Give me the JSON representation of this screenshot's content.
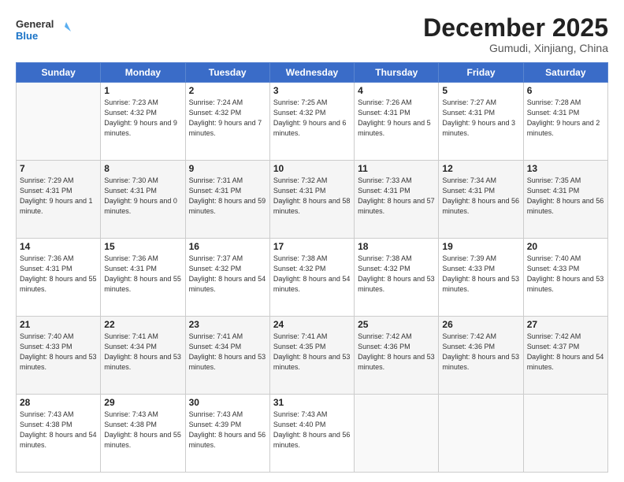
{
  "header": {
    "logo_line1": "General",
    "logo_line2": "Blue",
    "month": "December 2025",
    "location": "Gumudi, Xinjiang, China"
  },
  "weekdays": [
    "Sunday",
    "Monday",
    "Tuesday",
    "Wednesday",
    "Thursday",
    "Friday",
    "Saturday"
  ],
  "weeks": [
    [
      {
        "day": "",
        "sunrise": "",
        "sunset": "",
        "daylight": ""
      },
      {
        "day": "1",
        "sunrise": "Sunrise: 7:23 AM",
        "sunset": "Sunset: 4:32 PM",
        "daylight": "Daylight: 9 hours and 9 minutes."
      },
      {
        "day": "2",
        "sunrise": "Sunrise: 7:24 AM",
        "sunset": "Sunset: 4:32 PM",
        "daylight": "Daylight: 9 hours and 7 minutes."
      },
      {
        "day": "3",
        "sunrise": "Sunrise: 7:25 AM",
        "sunset": "Sunset: 4:32 PM",
        "daylight": "Daylight: 9 hours and 6 minutes."
      },
      {
        "day": "4",
        "sunrise": "Sunrise: 7:26 AM",
        "sunset": "Sunset: 4:31 PM",
        "daylight": "Daylight: 9 hours and 5 minutes."
      },
      {
        "day": "5",
        "sunrise": "Sunrise: 7:27 AM",
        "sunset": "Sunset: 4:31 PM",
        "daylight": "Daylight: 9 hours and 3 minutes."
      },
      {
        "day": "6",
        "sunrise": "Sunrise: 7:28 AM",
        "sunset": "Sunset: 4:31 PM",
        "daylight": "Daylight: 9 hours and 2 minutes."
      }
    ],
    [
      {
        "day": "7",
        "sunrise": "Sunrise: 7:29 AM",
        "sunset": "Sunset: 4:31 PM",
        "daylight": "Daylight: 9 hours and 1 minute."
      },
      {
        "day": "8",
        "sunrise": "Sunrise: 7:30 AM",
        "sunset": "Sunset: 4:31 PM",
        "daylight": "Daylight: 9 hours and 0 minutes."
      },
      {
        "day": "9",
        "sunrise": "Sunrise: 7:31 AM",
        "sunset": "Sunset: 4:31 PM",
        "daylight": "Daylight: 8 hours and 59 minutes."
      },
      {
        "day": "10",
        "sunrise": "Sunrise: 7:32 AM",
        "sunset": "Sunset: 4:31 PM",
        "daylight": "Daylight: 8 hours and 58 minutes."
      },
      {
        "day": "11",
        "sunrise": "Sunrise: 7:33 AM",
        "sunset": "Sunset: 4:31 PM",
        "daylight": "Daylight: 8 hours and 57 minutes."
      },
      {
        "day": "12",
        "sunrise": "Sunrise: 7:34 AM",
        "sunset": "Sunset: 4:31 PM",
        "daylight": "Daylight: 8 hours and 56 minutes."
      },
      {
        "day": "13",
        "sunrise": "Sunrise: 7:35 AM",
        "sunset": "Sunset: 4:31 PM",
        "daylight": "Daylight: 8 hours and 56 minutes."
      }
    ],
    [
      {
        "day": "14",
        "sunrise": "Sunrise: 7:36 AM",
        "sunset": "Sunset: 4:31 PM",
        "daylight": "Daylight: 8 hours and 55 minutes."
      },
      {
        "day": "15",
        "sunrise": "Sunrise: 7:36 AM",
        "sunset": "Sunset: 4:31 PM",
        "daylight": "Daylight: 8 hours and 55 minutes."
      },
      {
        "day": "16",
        "sunrise": "Sunrise: 7:37 AM",
        "sunset": "Sunset: 4:32 PM",
        "daylight": "Daylight: 8 hours and 54 minutes."
      },
      {
        "day": "17",
        "sunrise": "Sunrise: 7:38 AM",
        "sunset": "Sunset: 4:32 PM",
        "daylight": "Daylight: 8 hours and 54 minutes."
      },
      {
        "day": "18",
        "sunrise": "Sunrise: 7:38 AM",
        "sunset": "Sunset: 4:32 PM",
        "daylight": "Daylight: 8 hours and 53 minutes."
      },
      {
        "day": "19",
        "sunrise": "Sunrise: 7:39 AM",
        "sunset": "Sunset: 4:33 PM",
        "daylight": "Daylight: 8 hours and 53 minutes."
      },
      {
        "day": "20",
        "sunrise": "Sunrise: 7:40 AM",
        "sunset": "Sunset: 4:33 PM",
        "daylight": "Daylight: 8 hours and 53 minutes."
      }
    ],
    [
      {
        "day": "21",
        "sunrise": "Sunrise: 7:40 AM",
        "sunset": "Sunset: 4:33 PM",
        "daylight": "Daylight: 8 hours and 53 minutes."
      },
      {
        "day": "22",
        "sunrise": "Sunrise: 7:41 AM",
        "sunset": "Sunset: 4:34 PM",
        "daylight": "Daylight: 8 hours and 53 minutes."
      },
      {
        "day": "23",
        "sunrise": "Sunrise: 7:41 AM",
        "sunset": "Sunset: 4:34 PM",
        "daylight": "Daylight: 8 hours and 53 minutes."
      },
      {
        "day": "24",
        "sunrise": "Sunrise: 7:41 AM",
        "sunset": "Sunset: 4:35 PM",
        "daylight": "Daylight: 8 hours and 53 minutes."
      },
      {
        "day": "25",
        "sunrise": "Sunrise: 7:42 AM",
        "sunset": "Sunset: 4:36 PM",
        "daylight": "Daylight: 8 hours and 53 minutes."
      },
      {
        "day": "26",
        "sunrise": "Sunrise: 7:42 AM",
        "sunset": "Sunset: 4:36 PM",
        "daylight": "Daylight: 8 hours and 53 minutes."
      },
      {
        "day": "27",
        "sunrise": "Sunrise: 7:42 AM",
        "sunset": "Sunset: 4:37 PM",
        "daylight": "Daylight: 8 hours and 54 minutes."
      }
    ],
    [
      {
        "day": "28",
        "sunrise": "Sunrise: 7:43 AM",
        "sunset": "Sunset: 4:38 PM",
        "daylight": "Daylight: 8 hours and 54 minutes."
      },
      {
        "day": "29",
        "sunrise": "Sunrise: 7:43 AM",
        "sunset": "Sunset: 4:38 PM",
        "daylight": "Daylight: 8 hours and 55 minutes."
      },
      {
        "day": "30",
        "sunrise": "Sunrise: 7:43 AM",
        "sunset": "Sunset: 4:39 PM",
        "daylight": "Daylight: 8 hours and 56 minutes."
      },
      {
        "day": "31",
        "sunrise": "Sunrise: 7:43 AM",
        "sunset": "Sunset: 4:40 PM",
        "daylight": "Daylight: 8 hours and 56 minutes."
      },
      {
        "day": "",
        "sunrise": "",
        "sunset": "",
        "daylight": ""
      },
      {
        "day": "",
        "sunrise": "",
        "sunset": "",
        "daylight": ""
      },
      {
        "day": "",
        "sunrise": "",
        "sunset": "",
        "daylight": ""
      }
    ]
  ]
}
